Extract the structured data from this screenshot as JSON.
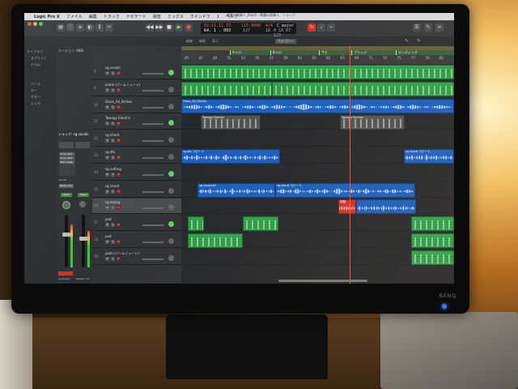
{
  "menubar": {
    "app": "Logic Pro X",
    "items": [
      "ファイル",
      "編集",
      "トラック",
      "ナビゲート",
      "録音",
      "ミックス",
      "ウインドウ",
      "1",
      "ヘルプ"
    ]
  },
  "window_title": "朝霧の演奏人_Real3 - 朝霧の演奏人 - トラック",
  "lcd": {
    "time": "02:11:11.73",
    "bars": "64. 1 . 003",
    "tempo": "115.0000",
    "signature": "4/4",
    "key": "C major",
    "tempo_small": "127",
    "division": "16",
    "cpu": "4 18 07 127"
  },
  "toolbar": {
    "edit": "編集",
    "functions": "機能",
    "view": "表示",
    "label": "カテゴリー"
  },
  "ruler_ticks": [
    "45",
    "47",
    "49",
    "51",
    "53",
    "55",
    "57",
    "59",
    "61",
    "63",
    "65",
    "67",
    "69",
    "71",
    "73",
    "75",
    "77",
    "79",
    "81"
  ],
  "markers": [
    {
      "label": "Aメロ"
    },
    {
      "label": "Bメロ"
    },
    {
      "label": "サビ"
    },
    {
      "label": "ブリッジ"
    },
    {
      "label": "エンディング"
    }
  ],
  "library": {
    "items": [
      "ライブラリ",
      "スプリット",
      "ドラム",
      "ベース",
      "キー",
      "ギター",
      "シンセ"
    ]
  },
  "inspector": {
    "region": "リージョン: MIDI",
    "track": "トラック: sg vocals",
    "eq": "EQ",
    "plugins": [
      "LF-LL Ultd",
      "LF-LL Ultd",
      "PAZ- Analy"
    ],
    "sends": "Sends",
    "output": "Stereo Out",
    "read1": "Read",
    "read2": "Read",
    "name1": "sg vocals",
    "name2": "Output 1-2"
  },
  "tracks": [
    {
      "num": "8",
      "name": "sg vocals"
    },
    {
      "num": "9",
      "name": "piano (パームミュート)"
    },
    {
      "num": "10",
      "name": "Glass_All_Strikes"
    },
    {
      "num": "11",
      "name": "Twangy Electric"
    },
    {
      "num": "12",
      "name": "sg chord"
    },
    {
      "num": "13",
      "name": "sg dfx"
    },
    {
      "num": "14",
      "name": "sg cutting"
    },
    {
      "num": "15",
      "name": "sg chord"
    },
    {
      "num": "16",
      "name": "sg dialog"
    },
    {
      "num": "17",
      "name": "pad"
    },
    {
      "num": "18",
      "name": "pad"
    },
    {
      "num": "19",
      "name": "pads (パームミュート)"
    }
  ],
  "regions": {
    "twangy1": "Twangy Electric",
    "twangy2": "Twangy Electric",
    "vocal1": "sg vocals#2",
    "vocal2": "sg chord コピー 3",
    "dfx": "sg dfx コピー 2",
    "red": "試験",
    "blue_end": "sg chord コピー 2",
    "glass": "Glass_All_Strikes"
  },
  "button_labels": {
    "mute": "M",
    "solo": "S",
    "rec": "R"
  },
  "monitor_brand": "BENQ"
}
